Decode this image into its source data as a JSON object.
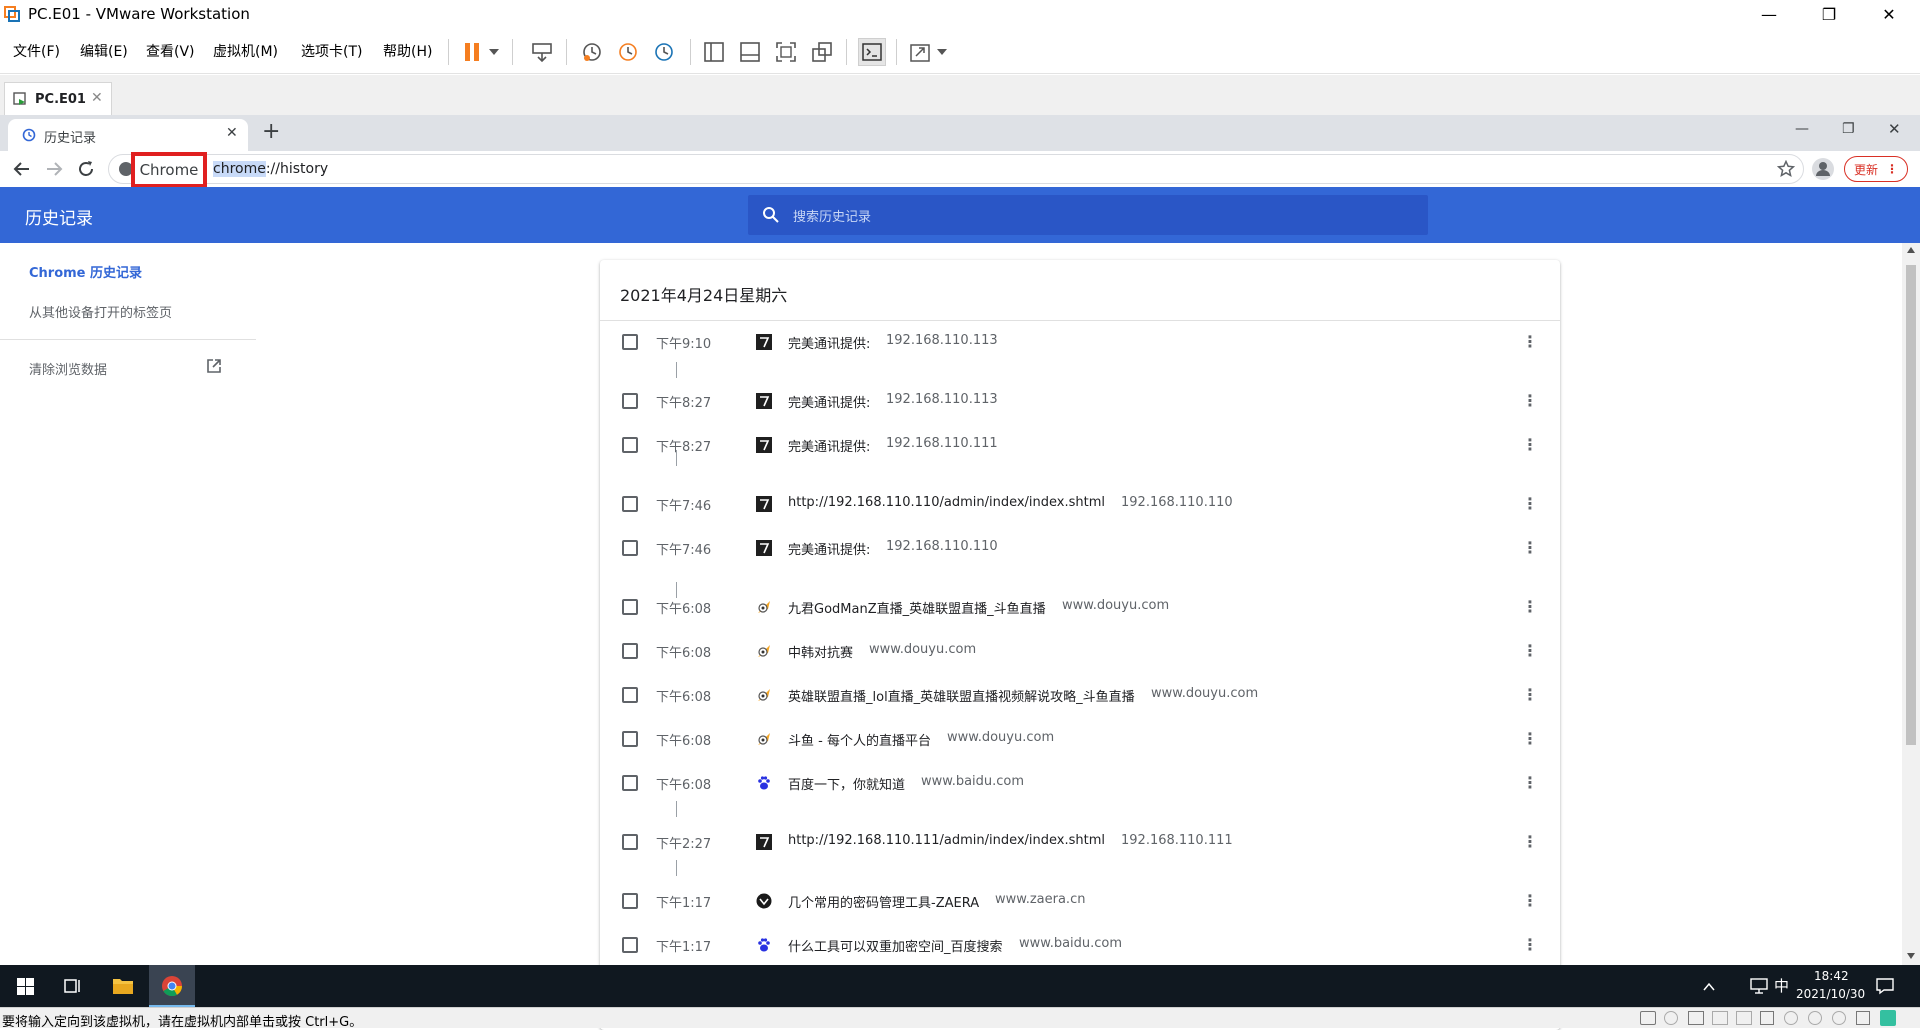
{
  "vmware": {
    "title": "PC.E01 - VMware Workstation",
    "menu": [
      "文件(F)",
      "编辑(E)",
      "查看(V)",
      "虚拟机(M)",
      "选项卡(T)",
      "帮助(H)"
    ],
    "tab_label": "PC.E01",
    "status_text": "要将输入定向到该虚拟机，请在虚拟机内部单击或按 Ctrl+G。"
  },
  "chrome": {
    "tab_title": "历史记录",
    "omni_chip": "Chrome",
    "url_scheme": "chrome",
    "url_rest": "://history",
    "update_label": "更新"
  },
  "history": {
    "title": "历史记录",
    "search_placeholder": "搜索历史记录",
    "sidebar": {
      "chrome_history": "Chrome 历史记录",
      "other_devices": "从其他设备打开的标签页",
      "clear_data": "清除浏览数据"
    },
    "date_header": "2021年4月24日星期六",
    "entries": [
      {
        "time": "下午9:10",
        "title": "完美通讯提供:",
        "domain": "192.168.110.113",
        "icon": "dark-site-icon"
      },
      {
        "time": "下午8:27",
        "title": "完美通讯提供:",
        "domain": "192.168.110.113",
        "icon": "dark-site-icon"
      },
      {
        "time": "下午8:27",
        "title": "完美通讯提供:",
        "domain": "192.168.110.111",
        "icon": "dark-site-icon"
      },
      {
        "time": "下午7:46",
        "title": "http://192.168.110.110/admin/index/index.shtml",
        "domain": "192.168.110.110",
        "icon": "dark-site-icon"
      },
      {
        "time": "下午7:46",
        "title": "完美通讯提供:",
        "domain": "192.168.110.110",
        "icon": "dark-site-icon"
      },
      {
        "time": "下午6:08",
        "title": "九君GodManZ直播_英雄联盟直播_斗鱼直播",
        "domain": "www.douyu.com",
        "icon": "douyu-icon"
      },
      {
        "time": "下午6:08",
        "title": "中韩对抗赛",
        "domain": "www.douyu.com",
        "icon": "douyu-icon"
      },
      {
        "time": "下午6:08",
        "title": "英雄联盟直播_lol直播_英雄联盟直播视频解说攻略_斗鱼直播",
        "domain": "www.douyu.com",
        "icon": "douyu-icon"
      },
      {
        "time": "下午6:08",
        "title": "斗鱼 - 每个人的直播平台",
        "domain": "www.douyu.com",
        "icon": "douyu-icon"
      },
      {
        "time": "下午6:08",
        "title": "百度一下，你就知道",
        "domain": "www.baidu.com",
        "icon": "baidu-icon"
      },
      {
        "time": "下午2:27",
        "title": "http://192.168.110.111/admin/index/index.shtml",
        "domain": "192.168.110.111",
        "icon": "dark-site-icon"
      },
      {
        "time": "下午1:17",
        "title": "几个常用的密码管理工具-ZAERA",
        "domain": "www.zaera.cn",
        "icon": "zaera-icon"
      },
      {
        "time": "下午1:17",
        "title": "什么工具可以双重加密空间_百度搜索",
        "domain": "www.baidu.com",
        "icon": "baidu-icon"
      }
    ]
  },
  "taskbar": {
    "ime": "中",
    "time": "18:42",
    "date": "2021/10/30"
  },
  "colors": {
    "header_blue": "#3367d6",
    "search_blue": "#2a56c6",
    "highlight_red": "#e02020",
    "link_blue": "#3367d6"
  }
}
